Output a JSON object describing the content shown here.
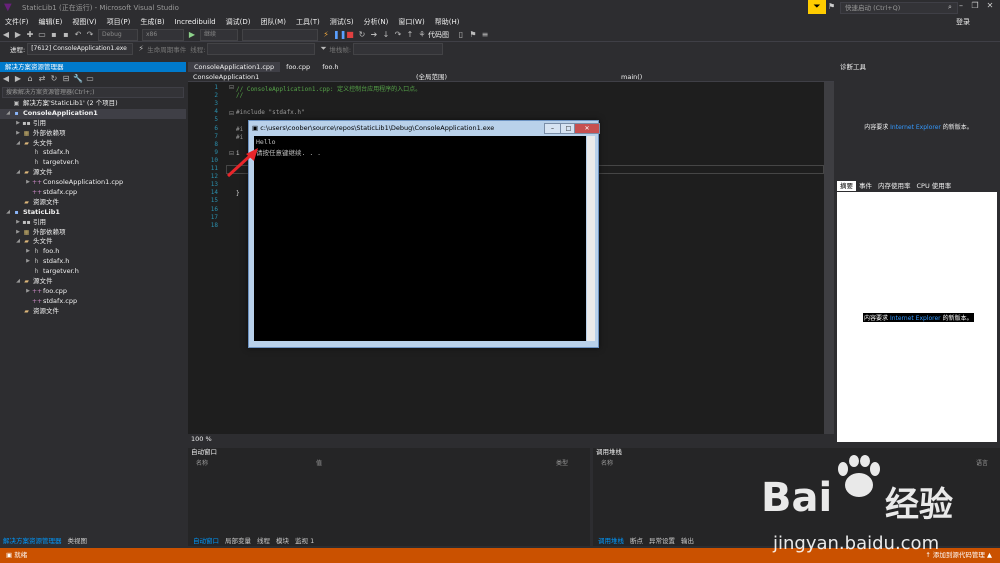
{
  "window": {
    "title": "StaticLib1 (正在运行) - Microsoft Visual Studio",
    "quick_launch_placeholder": "快速启动 (Ctrl+Q)",
    "login": "登录"
  },
  "menu": [
    "文件(F)",
    "编辑(E)",
    "视图(V)",
    "项目(P)",
    "生成(B)",
    "Incredibuild",
    "调试(D)",
    "团队(M)",
    "工具(T)",
    "测试(S)",
    "分析(N)",
    "窗口(W)",
    "帮助(H)"
  ],
  "toolbar": {
    "config": "Debug",
    "platform": "x86",
    "continue": "继续",
    "code_map": "代码图"
  },
  "toolbar2": {
    "process_label": "进程:",
    "process_value": "[7612] ConsoleApplication1.exe",
    "lifecycle": "生命周期事件",
    "thread_label": "线程:",
    "stackframe_label": "堆栈帧:"
  },
  "solution_explorer": {
    "title": "解决方案资源管理器",
    "search_placeholder": "搜索解决方案资源管理器(Ctrl+;)",
    "items": [
      {
        "label": "解决方案'StaticLib1' (2 个项目)",
        "icon": "solution-icon"
      },
      {
        "label": "ConsoleApplication1",
        "icon": "project-icon"
      },
      {
        "label": "引用",
        "icon": "references-icon"
      },
      {
        "label": "外部依赖项",
        "icon": "external-deps-icon"
      },
      {
        "label": "头文件",
        "icon": "folder-icon"
      },
      {
        "label": "stdafx.h",
        "icon": "header-file-icon"
      },
      {
        "label": "targetver.h",
        "icon": "header-file-icon"
      },
      {
        "label": "源文件",
        "icon": "folder-icon"
      },
      {
        "label": "ConsoleApplication1.cpp",
        "icon": "cpp-file-icon"
      },
      {
        "label": "stdafx.cpp",
        "icon": "cpp-file-icon"
      },
      {
        "label": "资源文件",
        "icon": "folder-icon"
      },
      {
        "label": "StaticLib1",
        "icon": "project-icon"
      },
      {
        "label": "引用",
        "icon": "references-icon"
      },
      {
        "label": "外部依赖项",
        "icon": "external-deps-icon"
      },
      {
        "label": "头文件",
        "icon": "folder-icon"
      },
      {
        "label": "foo.h",
        "icon": "header-file-icon"
      },
      {
        "label": "stdafx.h",
        "icon": "header-file-icon"
      },
      {
        "label": "targetver.h",
        "icon": "header-file-icon"
      },
      {
        "label": "源文件",
        "icon": "folder-icon"
      },
      {
        "label": "foo.cpp",
        "icon": "cpp-file-icon"
      },
      {
        "label": "stdafx.cpp",
        "icon": "cpp-file-icon"
      },
      {
        "label": "资源文件",
        "icon": "folder-icon"
      }
    ],
    "bottom_tabs": [
      "解决方案资源管理器",
      "类视图"
    ]
  },
  "editor": {
    "tabs": [
      "ConsoleApplication1.cpp",
      "foo.cpp",
      "foo.h"
    ],
    "nav_project": "ConsoleApplication1",
    "nav_scope": "(全局范围)",
    "nav_function": "main()",
    "line_numbers": [
      "1",
      "2",
      "3",
      "4",
      "5",
      "6",
      "7",
      "8",
      "9",
      "10",
      "11",
      "12",
      "13",
      "14",
      "15",
      "16",
      "17",
      "18"
    ],
    "code": {
      "l1": "// ConsoleApplication1.cpp: 定义控制台应用程序的入口点。",
      "l2": "//",
      "l4": "#include \"stdafx.h\"",
      "l6": "#i",
      "l7": "#i",
      "l9": "i",
      "l13": "}"
    },
    "zoom": "100 %"
  },
  "console": {
    "title": "c:\\users\\coober\\source\\repos\\StaticLib1\\Debug\\ConsoleApplication1.exe",
    "line1": "Hello",
    "line2": "请按任意键继续. . ."
  },
  "diagnostics": {
    "title": "诊断工具",
    "message_prefix": "内容要求",
    "message_link": "Internet Explorer",
    "message_suffix": "的新版本。",
    "tabs": [
      "摘要",
      "事件",
      "内存使用率",
      "CPU 使用率"
    ]
  },
  "autos": {
    "title": "自动窗口",
    "columns": [
      "名称",
      "值",
      "类型"
    ],
    "tabs": [
      "自动窗口",
      "局部变量",
      "线程",
      "模块",
      "监视 1"
    ]
  },
  "callstack": {
    "title": "调用堆栈",
    "columns": [
      "名称",
      "语言"
    ],
    "tabs": [
      "调用堆栈",
      "断点",
      "异常设置",
      "输出"
    ]
  },
  "status": {
    "left": "就绪",
    "right": "添加到源代码管理"
  },
  "watermark": {
    "brand": "Bai",
    "brand2": "经验",
    "url": "jingyan.baidu.com"
  },
  "colors": {
    "accent": "#007acc",
    "statusbar": "#ca5100",
    "editor_bg": "#1e1e1e"
  }
}
